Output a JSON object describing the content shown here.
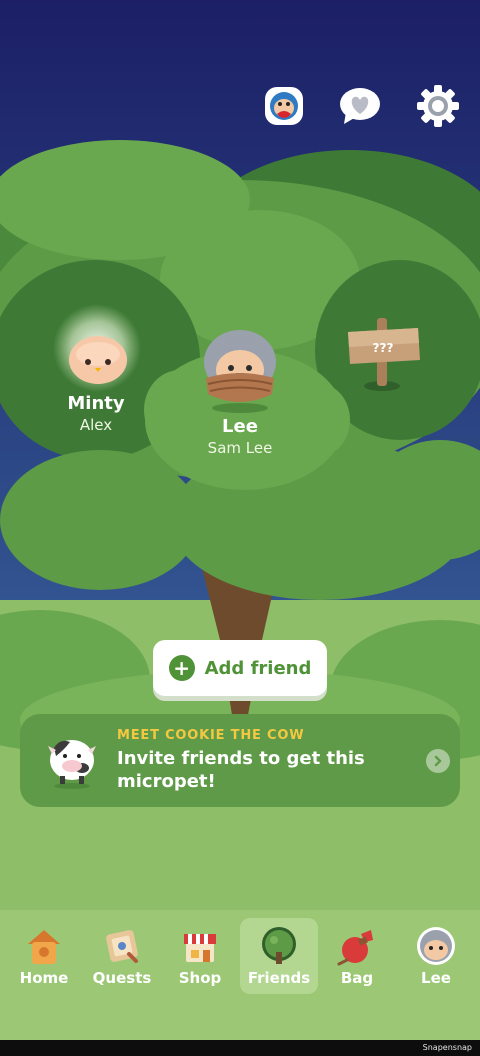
{
  "header": {
    "icons": [
      "profile-bird-icon",
      "chat-heart-icon",
      "gear-icon"
    ]
  },
  "friends": [
    {
      "name": "Minty",
      "owner": "Alex"
    },
    {
      "name": "Lee",
      "owner": "Sam Lee"
    }
  ],
  "mystery_sign": {
    "label": "???"
  },
  "add_friend": {
    "label": "Add friend"
  },
  "promo": {
    "kicker": "MEET COOKIE THE COW",
    "text": "Invite friends to get this micropet!"
  },
  "nav": {
    "items": [
      {
        "label": "Home",
        "icon": "birdhouse-icon"
      },
      {
        "label": "Quests",
        "icon": "quest-map-icon"
      },
      {
        "label": "Shop",
        "icon": "shop-icon"
      },
      {
        "label": "Friends",
        "icon": "tree-icon",
        "active": true
      },
      {
        "label": "Bag",
        "icon": "bag-icon"
      },
      {
        "label": "Lee",
        "icon": "pet-avatar-icon"
      }
    ]
  },
  "system_bar": {
    "watermark": "Snapensnap"
  },
  "colors": {
    "sky_top": "#1c1f66",
    "sky_bottom": "#3d6fa5",
    "leaf_dark": "#3e7a36",
    "leaf_mid": "#5d9b47",
    "leaf_light": "#79b45a",
    "accent_green": "#4f9237",
    "kicker_yellow": "#f5c842"
  }
}
